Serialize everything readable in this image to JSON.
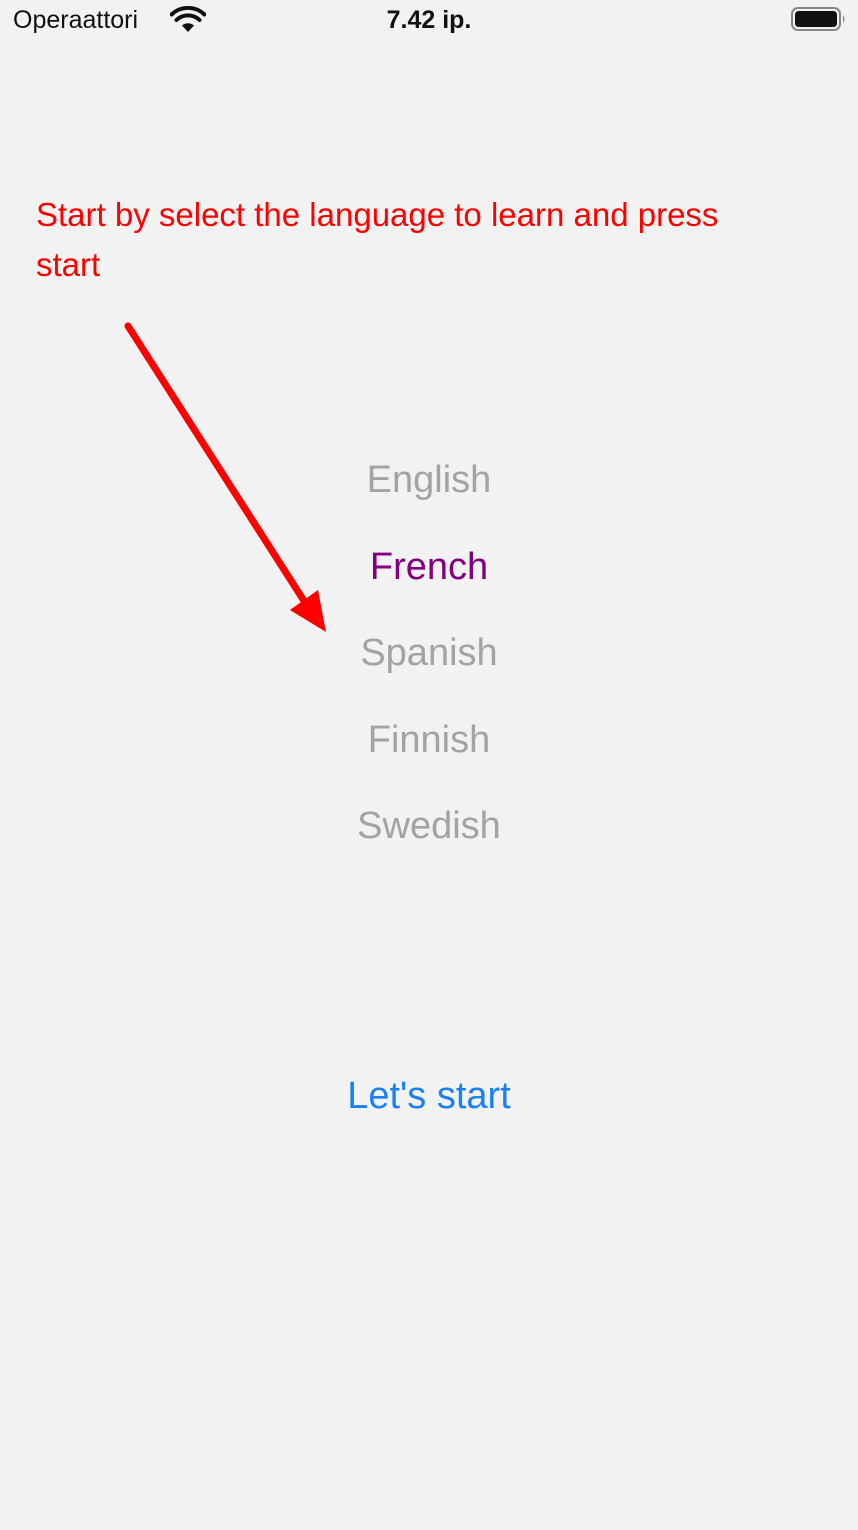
{
  "status_bar": {
    "carrier": "Operaattori",
    "time": "7.42 ip.",
    "icons": [
      "wifi-icon",
      "battery-icon"
    ]
  },
  "instruction": {
    "text": "Start by select the language to learn and press start",
    "color": "#ff0000"
  },
  "picker": {
    "selected": "French",
    "selected_color": "#800080",
    "items": [
      {
        "label": "English"
      },
      {
        "label": "French"
      },
      {
        "label": "Spanish"
      },
      {
        "label": "Finnish"
      },
      {
        "label": "Swedish"
      }
    ]
  },
  "start_button": {
    "label": "Let's start",
    "color": "#1a82f0"
  }
}
